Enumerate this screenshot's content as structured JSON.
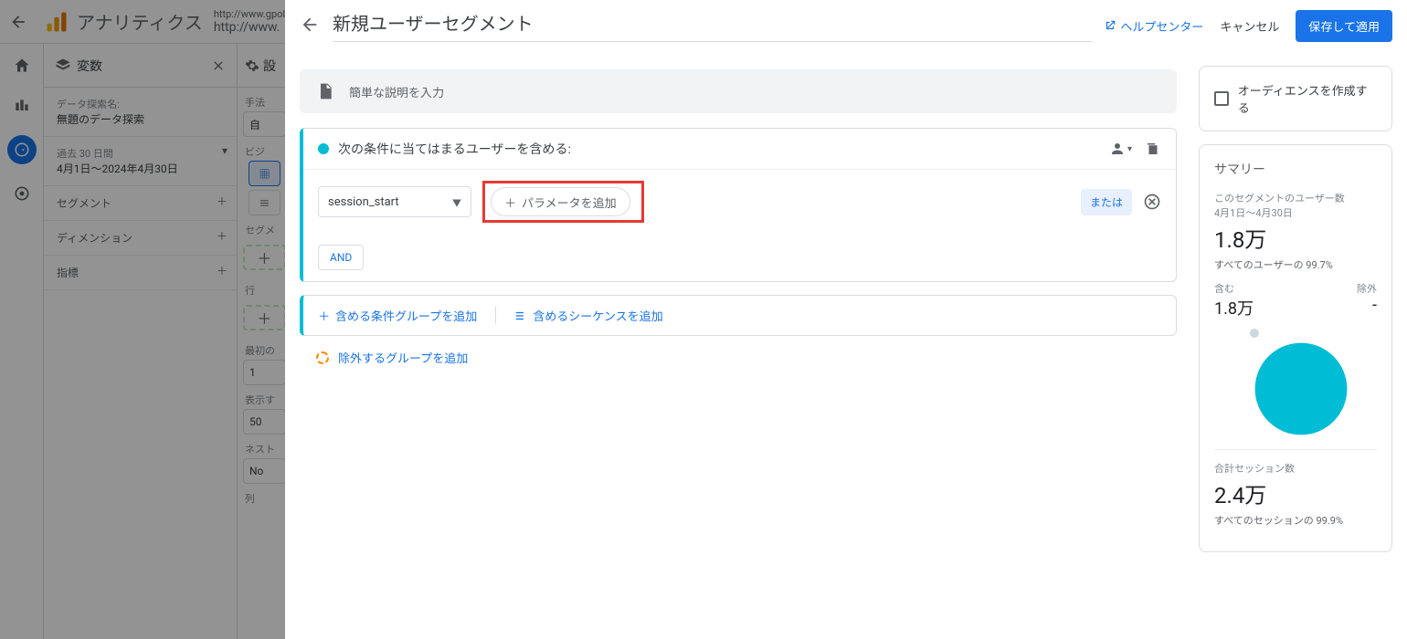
{
  "app": {
    "product": "アナリティクス",
    "url_small": "http://www.gpol.co.jp",
    "url_big": "http://www."
  },
  "varpanel": {
    "title": "変数",
    "name_lbl": "データ探索名:",
    "name_val": "無題のデータ探索",
    "date_lbl": "過去 30 日間",
    "date_val": "4月1日～2024年4月30日",
    "segments": "セグメント",
    "dimensions": "ディメンション",
    "metrics": "指標"
  },
  "setpanel": {
    "title": "設",
    "method_lbl": "手法",
    "method_val": "自",
    "viz_lbl": "ビジ",
    "seg_lbl": "セグメ",
    "rows_lbl": "行",
    "first_lbl": "最初の",
    "first_val": "1",
    "show_lbl": "表示す",
    "show_val": "50",
    "nest_lbl": "ネスト",
    "nest_val": "No",
    "cols_lbl": "列"
  },
  "modal": {
    "title": "新規ユーザーセグメント",
    "help": "ヘルプセンター",
    "cancel": "キャンセル",
    "save": "保存して適用",
    "desc_placeholder": "簡単な説明を入力",
    "include_label": "次の条件に当てはまるユーザーを含める:",
    "event": "session_start",
    "add_param": "パラメータを追加",
    "or": "または",
    "and": "AND",
    "add_cond_group": "含める条件グループを追加",
    "add_sequence": "含めるシーケンスを追加",
    "exclude_group": "除外するグループを追加"
  },
  "summary": {
    "create_audience": "オーディエンスを作成する",
    "title": "サマリー",
    "users_lbl": "このセグメントのユーザー数",
    "users_range": "4月1日～4月30日",
    "users_val": "1.8万",
    "users_sub": "すべてのユーザーの 99.7%",
    "include_lbl": "含む",
    "exclude_lbl": "除外",
    "include_val": "1.8万",
    "exclude_val": "-",
    "sessions_lbl": "合計セッション数",
    "sessions_val": "2.4万",
    "sessions_sub": "すべてのセッションの 99.9%"
  },
  "colors": {
    "accent": "#00bcd4",
    "primary": "#1a73e8"
  }
}
